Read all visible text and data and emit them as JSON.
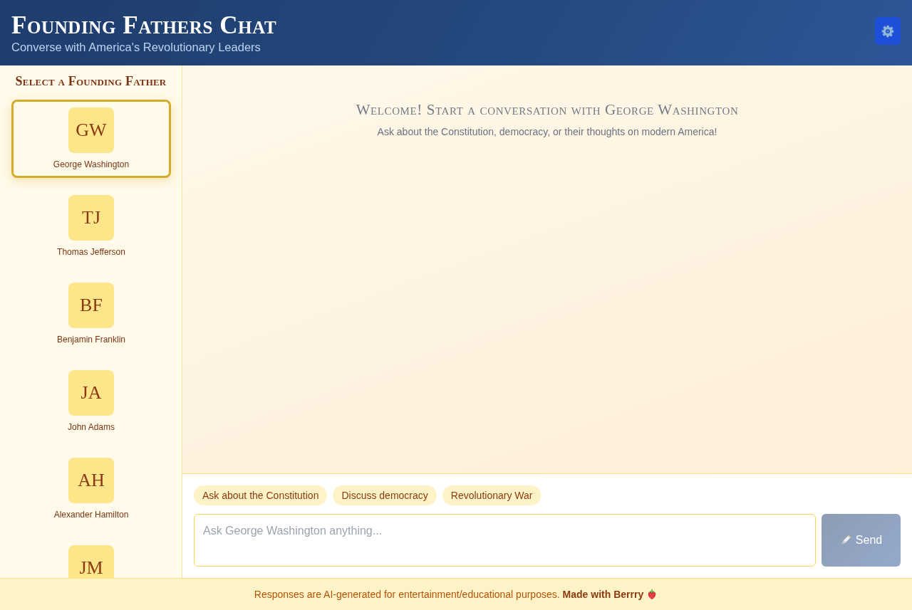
{
  "header": {
    "title": "Founding Fathers Chat",
    "subtitle": "Converse with America's Revolutionary Leaders"
  },
  "sidebar": {
    "heading": "Select a Founding Father",
    "figures": [
      {
        "initials": "GW",
        "name": "George Washington",
        "selected": true
      },
      {
        "initials": "TJ",
        "name": "Thomas Jefferson",
        "selected": false
      },
      {
        "initials": "BF",
        "name": "Benjamin Franklin",
        "selected": false
      },
      {
        "initials": "JA",
        "name": "John Adams",
        "selected": false
      },
      {
        "initials": "AH",
        "name": "Alexander Hamilton",
        "selected": false
      },
      {
        "initials": "JM",
        "selected": false
      }
    ]
  },
  "welcome": {
    "title": "Welcome! Start a conversation with George Washington",
    "subtitle": "Ask about the Constitution, democracy, or their thoughts on modern America!"
  },
  "suggestions": [
    "Ask about the Constitution",
    "Discuss democracy",
    "Revolutionary War"
  ],
  "composer": {
    "placeholder": "Ask George Washington anything...",
    "send_button": {
      "label": "Send",
      "disabled": true
    }
  },
  "footer": {
    "text": "Responses are AI-generated for entertainment/educational purposes.",
    "link": "Made with Berrry"
  }
}
